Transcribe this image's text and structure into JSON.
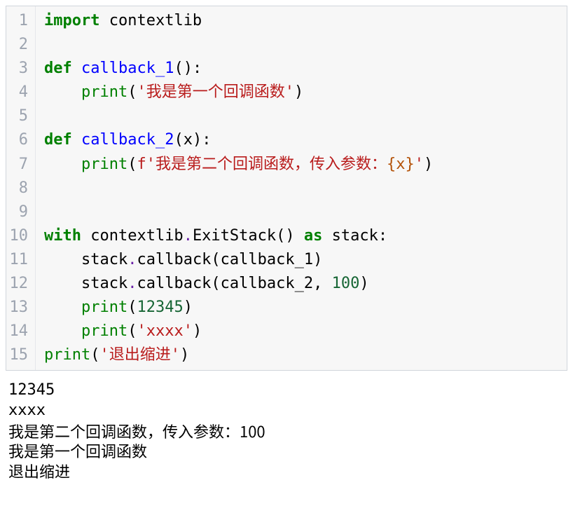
{
  "code": {
    "line_count": 15,
    "lines": [
      {
        "n": 1,
        "segs": [
          {
            "cls": "kw",
            "t": "import"
          },
          {
            "cls": "plain",
            "t": " contextlib"
          }
        ]
      },
      {
        "n": 2,
        "segs": []
      },
      {
        "n": 3,
        "segs": [
          {
            "cls": "kw",
            "t": "def"
          },
          {
            "cls": "plain",
            "t": " "
          },
          {
            "cls": "fn",
            "t": "callback_1"
          },
          {
            "cls": "plain",
            "t": "():"
          }
        ]
      },
      {
        "n": 4,
        "segs": [
          {
            "cls": "plain",
            "t": "    "
          },
          {
            "cls": "builtin",
            "t": "print"
          },
          {
            "cls": "plain",
            "t": "("
          },
          {
            "cls": "str",
            "t": "'我是第一个回调函数'"
          },
          {
            "cls": "plain",
            "t": ")"
          }
        ]
      },
      {
        "n": 5,
        "segs": []
      },
      {
        "n": 6,
        "segs": [
          {
            "cls": "kw",
            "t": "def"
          },
          {
            "cls": "plain",
            "t": " "
          },
          {
            "cls": "fn",
            "t": "callback_2"
          },
          {
            "cls": "plain",
            "t": "(x):"
          }
        ]
      },
      {
        "n": 7,
        "segs": [
          {
            "cls": "plain",
            "t": "    "
          },
          {
            "cls": "builtin",
            "t": "print"
          },
          {
            "cls": "plain",
            "t": "("
          },
          {
            "cls": "fpre",
            "t": "f"
          },
          {
            "cls": "fstr",
            "t": "'我是第二个回调函数，传入参数："
          },
          {
            "cls": "interp",
            "t": "{x}"
          },
          {
            "cls": "fstr",
            "t": "'"
          },
          {
            "cls": "plain",
            "t": ")"
          }
        ]
      },
      {
        "n": 8,
        "segs": []
      },
      {
        "n": 9,
        "segs": []
      },
      {
        "n": 10,
        "segs": [
          {
            "cls": "kw",
            "t": "with"
          },
          {
            "cls": "plain",
            "t": " contextlib"
          },
          {
            "cls": "op",
            "t": "."
          },
          {
            "cls": "plain",
            "t": "ExitStack() "
          },
          {
            "cls": "kw",
            "t": "as"
          },
          {
            "cls": "plain",
            "t": " stack:"
          }
        ]
      },
      {
        "n": 11,
        "segs": [
          {
            "cls": "plain",
            "t": "    stack"
          },
          {
            "cls": "op",
            "t": "."
          },
          {
            "cls": "plain",
            "t": "callback(callback_1)"
          }
        ]
      },
      {
        "n": 12,
        "segs": [
          {
            "cls": "plain",
            "t": "    stack"
          },
          {
            "cls": "op",
            "t": "."
          },
          {
            "cls": "plain",
            "t": "callback(callback_2, "
          },
          {
            "cls": "num",
            "t": "100"
          },
          {
            "cls": "plain",
            "t": ")"
          }
        ]
      },
      {
        "n": 13,
        "segs": [
          {
            "cls": "plain",
            "t": "    "
          },
          {
            "cls": "builtin",
            "t": "print"
          },
          {
            "cls": "plain",
            "t": "("
          },
          {
            "cls": "num",
            "t": "12345"
          },
          {
            "cls": "plain",
            "t": ")"
          }
        ]
      },
      {
        "n": 14,
        "segs": [
          {
            "cls": "plain",
            "t": "    "
          },
          {
            "cls": "builtin",
            "t": "print"
          },
          {
            "cls": "plain",
            "t": "("
          },
          {
            "cls": "str",
            "t": "'xxxx'"
          },
          {
            "cls": "plain",
            "t": ")"
          }
        ]
      },
      {
        "n": 15,
        "segs": [
          {
            "cls": "builtin",
            "t": "print"
          },
          {
            "cls": "plain",
            "t": "("
          },
          {
            "cls": "str",
            "t": "'退出缩进'"
          },
          {
            "cls": "plain",
            "t": ")"
          }
        ]
      }
    ]
  },
  "output": {
    "lines": [
      "12345",
      "xxxx",
      "我是第二个回调函数，传入参数：100",
      "我是第一个回调函数",
      "退出缩进"
    ]
  }
}
